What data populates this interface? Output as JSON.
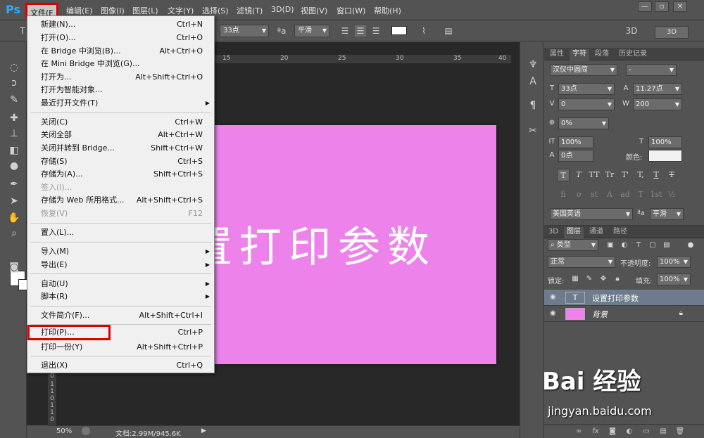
{
  "app": {
    "logo": "Ps"
  },
  "menubar": {
    "items": [
      "文件(F",
      "编辑(E)",
      "图像(I)",
      "图层(L)",
      "文字(Y)",
      "选择(S)",
      "滤镜(T)",
      "3D(D)",
      "视图(V)",
      "窗口(W)",
      "帮助(H)"
    ],
    "active_index": 0
  },
  "window_controls": {
    "minimize": "—",
    "restore": "▫",
    "close": "✕"
  },
  "options": {
    "font_size": "33点",
    "aa_label": "ªa",
    "antialias": "平滑",
    "btn_3d": "3D",
    "label_3d": "3D"
  },
  "file_menu": {
    "items": [
      {
        "label": "新建(N)...",
        "shortcut": "Ctrl+N"
      },
      {
        "label": "打开(O)...",
        "shortcut": "Ctrl+O"
      },
      {
        "label": "在 Bridge 中浏览(B)...",
        "shortcut": "Alt+Ctrl+O"
      },
      {
        "label": "在 Mini Bridge 中浏览(G)...",
        "shortcut": ""
      },
      {
        "label": "打开为...",
        "shortcut": "Alt+Shift+Ctrl+O"
      },
      {
        "label": "打开为智能对象...",
        "shortcut": ""
      },
      {
        "label": "最近打开文件(T)",
        "shortcut": "",
        "submenu": true
      },
      {
        "label": "关闭(C)",
        "shortcut": "Ctrl+W"
      },
      {
        "label": "关闭全部",
        "shortcut": "Alt+Ctrl+W"
      },
      {
        "label": "关闭并转到 Bridge...",
        "shortcut": "Shift+Ctrl+W"
      },
      {
        "label": "存储(S)",
        "shortcut": "Ctrl+S"
      },
      {
        "label": "存储为(A)...",
        "shortcut": "Shift+Ctrl+S"
      },
      {
        "label": "签入(I)...",
        "shortcut": "",
        "disabled": true
      },
      {
        "label": "存储为 Web 所用格式...",
        "shortcut": "Alt+Shift+Ctrl+S"
      },
      {
        "label": "恢复(V)",
        "shortcut": "F12",
        "disabled": true
      },
      {
        "label": "置入(L)...",
        "shortcut": ""
      },
      {
        "label": "导入(M)",
        "shortcut": "",
        "submenu": true
      },
      {
        "label": "导出(E)",
        "shortcut": "",
        "submenu": true
      },
      {
        "label": "自动(U)",
        "shortcut": "",
        "submenu": true
      },
      {
        "label": "脚本(R)",
        "shortcut": "",
        "submenu": true
      },
      {
        "label": "文件简介(F)...",
        "shortcut": "Alt+Shift+Ctrl+I"
      },
      {
        "label": "打印(P)...",
        "shortcut": "Ctrl+P",
        "highlighted": true
      },
      {
        "label": "打印一份(Y)",
        "shortcut": "Alt+Shift+Ctrl+P"
      },
      {
        "label": "退出(X)",
        "shortcut": "Ctrl+Q"
      }
    ]
  },
  "canvas": {
    "text": "置打印参数",
    "bg": "#ed82ea"
  },
  "rulers": {
    "top_ticks": [
      "15",
      "20",
      "25",
      "30",
      "35",
      "40"
    ],
    "left_ticks": [
      "0",
      "1",
      "1",
      "0",
      "1",
      "1",
      "0"
    ]
  },
  "status": {
    "zoom": "50%",
    "doc": "文档:2.99M/945.6K"
  },
  "char_panel": {
    "tabs": [
      "属性",
      "字符",
      "段落",
      "历史记录"
    ],
    "active_tab": 1,
    "font_family": "汉仪中圆简",
    "font_style": "-",
    "size": "33点",
    "leading": "11.27点",
    "kerning": "0",
    "tracking": "200",
    "vscale_pct": "0%",
    "h_scale": "100%",
    "v_scale": "100%",
    "baseline": "0点",
    "color_label": "颜色:",
    "style_buttons": [
      "T",
      "T",
      "TT",
      "Tr",
      "T'",
      "T,",
      "T",
      "T"
    ],
    "ot_buttons": [
      "fi",
      "ơ",
      "st",
      "A",
      "ad",
      "T",
      "1st",
      "½"
    ],
    "language": "美国英语",
    "aa_label": "ªa",
    "antialias": "平滑"
  },
  "layers_panel": {
    "tabs": [
      "3D",
      "图层",
      "通道",
      "路径"
    ],
    "active_tab": 1,
    "filter": "类型",
    "blend_mode": "正常",
    "opacity_label": "不透明度:",
    "opacity": "100%",
    "lock_label": "锁定:",
    "fill_label": "填充:",
    "fill": "100%",
    "layers": [
      {
        "name": "设置打印参数",
        "type": "text",
        "selected": true
      },
      {
        "name": "背景",
        "type": "fill",
        "color": "#ed82ea",
        "locked": true
      }
    ]
  },
  "watermark": {
    "brand": "Bai 经验",
    "url": "jingyan.baidu.com"
  }
}
